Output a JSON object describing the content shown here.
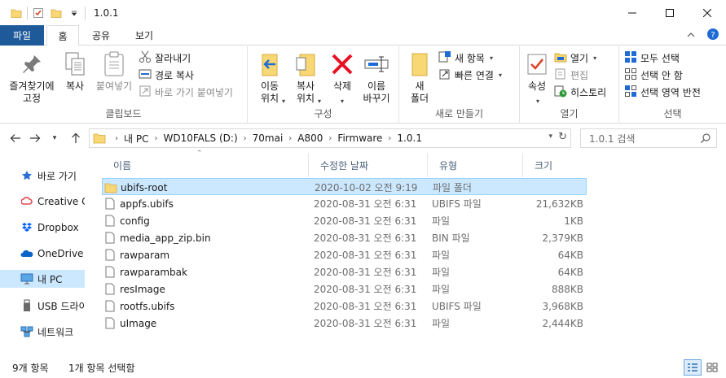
{
  "window": {
    "title": "1.0.1",
    "minimize_glyph": "—",
    "maximize_glyph": "☐",
    "close_glyph": "✕"
  },
  "ribbon_tabs": [
    "파일",
    "홈",
    "공유",
    "보기"
  ],
  "ribbon": {
    "clipboard": {
      "label": "클립보드",
      "pin": "즐겨찾기에\n고정",
      "copy": "복사",
      "paste": "붙여넣기",
      "cut": "잘라내기",
      "copy_path": "경로 복사",
      "paste_shortcut": "바로 가기 붙여넣기"
    },
    "organize": {
      "label": "구성",
      "move_to": "이동\n위치",
      "copy_to": "복사\n위치",
      "delete": "삭제",
      "rename": "이름\n바꾸기"
    },
    "new": {
      "label": "새로 만들기",
      "new_folder": "새\n폴더",
      "new_item": "새 항목",
      "easy_access": "빠른 연결"
    },
    "open": {
      "label": "열기",
      "properties": "속성",
      "open": "열기",
      "edit": "편집",
      "history": "히스토리"
    },
    "select": {
      "label": "선택",
      "select_all": "모두 선택",
      "select_none": "선택 안 함",
      "invert": "선택 영역 반전"
    }
  },
  "address": {
    "crumbs": [
      "내 PC",
      "WD10FALS (D:)",
      "70mai",
      "A800",
      "Firmware",
      "1.0.1"
    ],
    "search_placeholder": "1.0.1 검색"
  },
  "nav_pane": [
    {
      "label": "바로 가기",
      "icon": "star-icon"
    },
    {
      "label": "Creative Cl",
      "icon": "creative-cloud-icon"
    },
    {
      "label": "Dropbox",
      "icon": "dropbox-icon"
    },
    {
      "label": "OneDrive",
      "icon": "onedrive-icon"
    },
    {
      "label": "내 PC",
      "icon": "computer-icon"
    },
    {
      "label": "USB 드라이",
      "icon": "usb-drive-icon"
    },
    {
      "label": "네트워크",
      "icon": "network-icon"
    }
  ],
  "columns": {
    "name": "이름",
    "date": "수정한 날짜",
    "type": "유형",
    "size": "크기"
  },
  "files": [
    {
      "name": "ubifs-root",
      "date": "2020-10-02 오전 9:19",
      "type": "파일 폴더",
      "size": "",
      "icon": "folder-icon"
    },
    {
      "name": "appfs.ubifs",
      "date": "2020-08-31 오전 6:31",
      "type": "UBIFS 파일",
      "size": "21,632KB",
      "icon": "file-icon"
    },
    {
      "name": "config",
      "date": "2020-08-31 오전 6:31",
      "type": "파일",
      "size": "1KB",
      "icon": "file-icon"
    },
    {
      "name": "media_app_zip.bin",
      "date": "2020-08-31 오전 6:31",
      "type": "BIN 파일",
      "size": "2,379KB",
      "icon": "file-icon"
    },
    {
      "name": "rawparam",
      "date": "2020-08-31 오전 6:31",
      "type": "파일",
      "size": "64KB",
      "icon": "file-icon"
    },
    {
      "name": "rawparambak",
      "date": "2020-08-31 오전 6:31",
      "type": "파일",
      "size": "64KB",
      "icon": "file-icon"
    },
    {
      "name": "resImage",
      "date": "2020-08-31 오전 6:31",
      "type": "파일",
      "size": "888KB",
      "icon": "file-icon"
    },
    {
      "name": "rootfs.ubifs",
      "date": "2020-08-31 오전 6:31",
      "type": "UBIFS 파일",
      "size": "3,968KB",
      "icon": "file-icon"
    },
    {
      "name": "uImage",
      "date": "2020-08-31 오전 6:31",
      "type": "파일",
      "size": "2,444KB",
      "icon": "file-icon"
    }
  ],
  "status": {
    "count": "9개 항목",
    "selected": "1개 항목 선택함"
  },
  "colors": {
    "file_tab": "#1e5a9a",
    "selection": "#cce8ff",
    "selection_border": "#99d1ff",
    "folder": "#f8d775",
    "delete_red": "#e81123"
  }
}
